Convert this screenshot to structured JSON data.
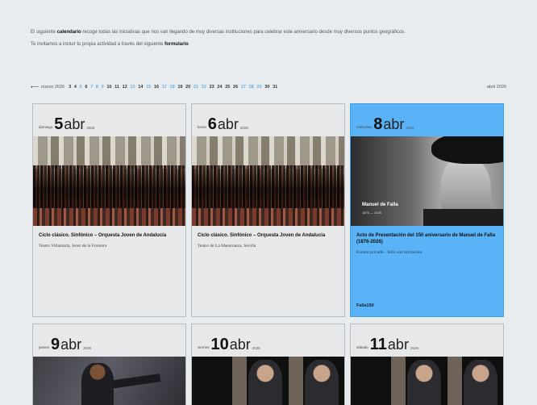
{
  "intro": {
    "p1_pre": "El siguiente",
    "p1_bold": "calendario",
    "p1_post": "recoge todas las iniciativas que nos van llegando de muy diversas instituciones para celebrar este aniversario desde muy diversos puntos geográficos.",
    "p2_pre": "Te invitamos a incluir tu propia actividad a través del siguiente",
    "p2_bold": "formulario"
  },
  "datebar": {
    "prev_arrow": "⟵",
    "prev_month": "marzo 2026",
    "next_month": "abril 2026",
    "days": [
      {
        "n": "3"
      },
      {
        "n": "4"
      },
      {
        "n": "5",
        "hl": true
      },
      {
        "n": "6"
      },
      {
        "n": "7",
        "hl": true
      },
      {
        "n": "8",
        "hl": true
      },
      {
        "n": "9",
        "hl": true
      },
      {
        "n": "10"
      },
      {
        "n": "11"
      },
      {
        "n": "12"
      },
      {
        "n": "13",
        "hl": true
      },
      {
        "n": "14"
      },
      {
        "n": "15",
        "hl": true
      },
      {
        "n": "16"
      },
      {
        "n": "17",
        "hl": true
      },
      {
        "n": "18",
        "hl": true
      },
      {
        "n": "19"
      },
      {
        "n": "20"
      },
      {
        "n": "21",
        "hl": true
      },
      {
        "n": "22",
        "hl": true
      },
      {
        "n": "23"
      },
      {
        "n": "24"
      },
      {
        "n": "25"
      },
      {
        "n": "26"
      },
      {
        "n": "27",
        "hl": true
      },
      {
        "n": "28",
        "hl": true
      },
      {
        "n": "29",
        "hl": true
      },
      {
        "n": "30"
      },
      {
        "n": "31"
      }
    ]
  },
  "cards": [
    {
      "weekday": "domingo",
      "day": "5",
      "month": "abr",
      "year": "2026",
      "title": "Ciclo clásico. Sinfónico – Orquesta Joven de Andalucía",
      "venue": "Teatro Villamarta, Jerez de la Frontera"
    },
    {
      "weekday": "lunes",
      "day": "6",
      "month": "abr",
      "year": "2026",
      "title": "Ciclo clásico. Sinfónico – Orquesta Joven de Andalucía",
      "venue": "Teatro de La Maestranza, Sevilla"
    },
    {
      "weekday": "miércoles",
      "day": "8",
      "month": "abr",
      "year": "2026",
      "title": "Acto de Presentación del 150 aniversario de Manuel de Falla (1876-2026)",
      "venue": "Evento privado · Solo con invitación",
      "tag": "Falla150",
      "img_caption": "Manuel de Falla",
      "img_sub": "1876 — 2026"
    },
    {
      "weekday": "jueves",
      "day": "9",
      "month": "abr",
      "year": "2026"
    },
    {
      "weekday": "viernes",
      "day": "10",
      "month": "abr",
      "year": "2026"
    },
    {
      "weekday": "sábado",
      "day": "11",
      "month": "abr",
      "year": "2026"
    }
  ],
  "colors": {
    "background": "#e9ecee",
    "highlight_card": "#5ab3f7",
    "highlight_day": "#5fb0ef"
  }
}
